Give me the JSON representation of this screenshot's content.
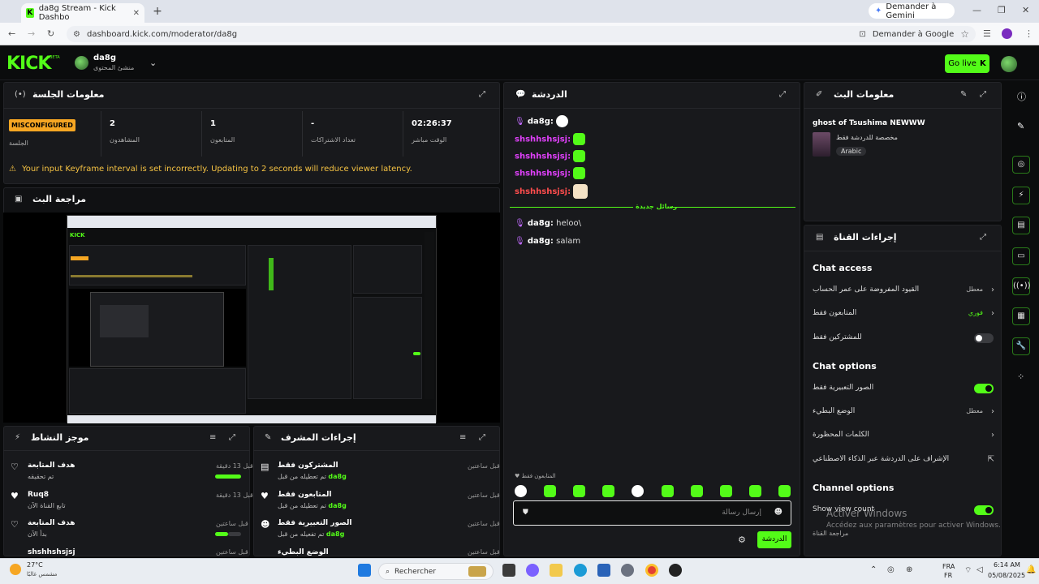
{
  "browser": {
    "tab_title": "da8g Stream - Kick Dashbo",
    "gemini_button": "Demander à Gemini",
    "url": "dashboard.kick.com/moderator/da8g",
    "ask_google": "Demander à Google"
  },
  "header": {
    "logo": "KICK",
    "beta": "BETA",
    "username": "da8g",
    "role": "منشئ المحتوى",
    "go_live": "Go live"
  },
  "session": {
    "title": "معلومات الجلسة",
    "status_badge": "MISCONFIGURED",
    "status_label": "الجلسة",
    "viewers_value": "2",
    "viewers_label": "المشاهدون",
    "followers_value": "1",
    "followers_label": "المتابعون",
    "subs_value": "-",
    "subs_label": "تعداد الاشتراكات",
    "uptime_value": "02:26:37",
    "uptime_label": "الوقت مباشر",
    "warning": "Your input Keyframe interval is set incorrectly. Updating to 2 seconds will reduce viewer latency."
  },
  "preview": {
    "title": "مراجعة البث"
  },
  "activity": {
    "title": "موجز النشاط",
    "items": [
      {
        "title": "هدف المتابعة",
        "sub": "تم تحقيقه",
        "time": "قبل 13 دقيقة"
      },
      {
        "title": "Ruq8",
        "sub": "تابع القناة الآن",
        "time": "قبل 13 دقيقة"
      },
      {
        "title": "هدف المتابعة",
        "sub": "بدأ الآن",
        "time": "قبل ساعتين"
      },
      {
        "title": "shshhshsjsj",
        "sub": "",
        "time": "قبل ساعتين"
      }
    ]
  },
  "modactions": {
    "title": "إجراءات المشرف",
    "items": [
      {
        "title": "المشتركون فقط",
        "sub": "تم تعطيله من قبل",
        "user": "da8g",
        "time": "قبل ساعتين"
      },
      {
        "title": "المتابعون فقط",
        "sub": "تم تعطيله من قبل",
        "user": "da8g",
        "time": "قبل ساعتين"
      },
      {
        "title": "الصور التعبيرية فقط",
        "sub": "تم تفعيله من قبل",
        "user": "da8g",
        "time": "قبل ساعتين"
      },
      {
        "title": "الوضع البطيء",
        "sub": "",
        "user": "",
        "time": "قبل ساعتين"
      }
    ]
  },
  "chat": {
    "title": "الدردشة",
    "messages": [
      {
        "user": "da8g",
        "color": "#ffffff",
        "text": ""
      },
      {
        "user": "shshhshsjsj",
        "color": "#e040fb",
        "text": ""
      },
      {
        "user": "shshhshsjsj",
        "color": "#e040fb",
        "text": ""
      },
      {
        "user": "shshhshsjsj",
        "color": "#e040fb",
        "text": ""
      },
      {
        "user": "shshhshsjsj",
        "color": "#ff4d4d",
        "text": ""
      }
    ],
    "new_messages": "رسائل جديدة",
    "messages_after": [
      {
        "user": "da8g",
        "text": "heloo\\"
      },
      {
        "user": "da8g",
        "text": "salam"
      }
    ],
    "followers_only_hint": "المتابعون فقط",
    "input_placeholder": "إرسال رسالة",
    "send_button": "الدردشة"
  },
  "stream_info": {
    "title": "معلومات البث",
    "stream_title": "ghost of Tsushima NEWWW",
    "category": "مخصصة للدردشة فقط",
    "language": "Arabic"
  },
  "channel_actions": {
    "title": "إجراءات القناة",
    "chat_access": "Chat access",
    "account_age": "القيود المفروضة على عمر الحساب",
    "account_age_value": "معطل",
    "followers_only": "المتابعون فقط",
    "followers_only_value": "فوري",
    "subs_only": "للمشتركين فقط",
    "chat_options": "Chat options",
    "emotes_only": "الصور التعبيرية فقط",
    "slow_mode": "الوضع البطيء",
    "slow_mode_value": "معطل",
    "banned_words": "الكلمات المحظورة",
    "ai_mod": "الإشراف على الدردشة عبر الذكاء الاصطناعي",
    "channel_options": "Channel options",
    "show_view_count": "Show view count",
    "channel_review": "مراجعة القناة"
  },
  "windows": {
    "activate": "Activer Windows",
    "activate_sub": "Accédez aux paramètres pour activer Windows."
  },
  "taskbar": {
    "weather_temp": "27°C",
    "weather_desc": "مشمس غالبًا",
    "search": "Rechercher",
    "lang": "FRA",
    "lang2": "FR",
    "time": "6:14 AM",
    "date": "05/08/2025"
  },
  "colors": {
    "accent": "#53fc18",
    "warning": "#f6a623"
  }
}
